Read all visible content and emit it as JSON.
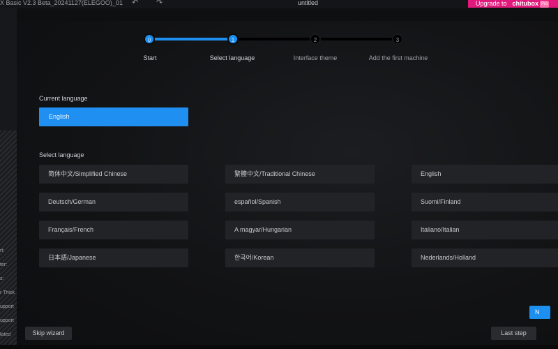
{
  "app": {
    "title": "X Basic V2.3 Beta_20241127(ELEGOO)_01",
    "document": "untitled",
    "undo_icon": "undo-icon",
    "redo_icon": "redo-icon",
    "upgrade_text": "Upgrade to",
    "upgrade_brand": "chitubox",
    "upgrade_tag": "Pro",
    "upgrade_color": "#e2197d"
  },
  "background_panel": {
    "labels": [
      "rt:",
      "ter:",
      "s:",
      "r Thick",
      "upport",
      "upport",
      "lated"
    ]
  },
  "wizard": {
    "accent_color": "#1d8ff0",
    "steps": [
      {
        "number": "0",
        "label": "Start",
        "state": "done"
      },
      {
        "number": "1",
        "label": "Select language",
        "state": "current"
      },
      {
        "number": "2",
        "label": "Interface theme",
        "state": "todo"
      },
      {
        "number": "3",
        "label": "Add the first machine",
        "state": "todo"
      }
    ],
    "current_language_label": "Current language",
    "current_language_value": "English",
    "select_language_label": "Select language",
    "languages": [
      "简体中文/Simplified Chinese",
      "繁體中文/Traditional Chinese",
      "English",
      "Deutsch/German",
      "español/Spanish",
      "Suomi/Finland",
      "Français/French",
      "A magyar/Hungarian",
      "Italiano/Italian",
      "日本語/Japanese",
      "한국어/Korean",
      "Nederlands/Holland"
    ],
    "skip_label": "Skip wizard",
    "last_step_label": "Last step",
    "next_label": "N"
  }
}
